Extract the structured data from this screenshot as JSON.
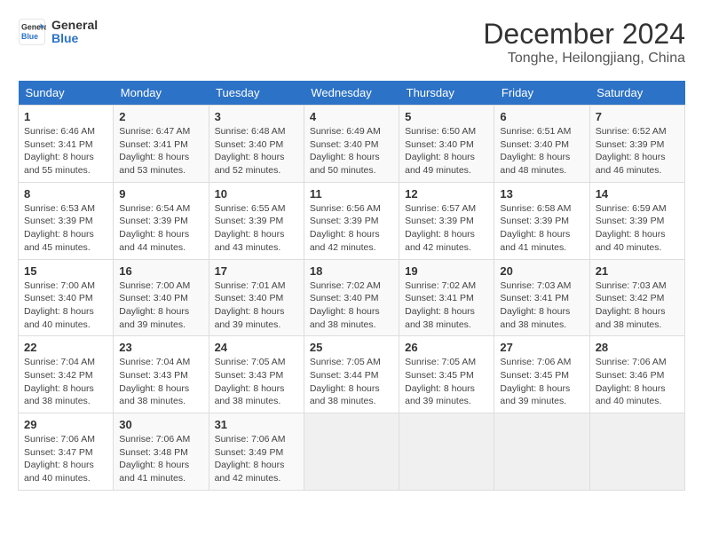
{
  "header": {
    "logo_line1": "General",
    "logo_line2": "Blue",
    "month": "December 2024",
    "location": "Tonghe, Heilongjiang, China"
  },
  "weekdays": [
    "Sunday",
    "Monday",
    "Tuesday",
    "Wednesday",
    "Thursday",
    "Friday",
    "Saturday"
  ],
  "weeks": [
    [
      {
        "day": "1",
        "info": "Sunrise: 6:46 AM\nSunset: 3:41 PM\nDaylight: 8 hours\nand 55 minutes."
      },
      {
        "day": "2",
        "info": "Sunrise: 6:47 AM\nSunset: 3:41 PM\nDaylight: 8 hours\nand 53 minutes."
      },
      {
        "day": "3",
        "info": "Sunrise: 6:48 AM\nSunset: 3:40 PM\nDaylight: 8 hours\nand 52 minutes."
      },
      {
        "day": "4",
        "info": "Sunrise: 6:49 AM\nSunset: 3:40 PM\nDaylight: 8 hours\nand 50 minutes."
      },
      {
        "day": "5",
        "info": "Sunrise: 6:50 AM\nSunset: 3:40 PM\nDaylight: 8 hours\nand 49 minutes."
      },
      {
        "day": "6",
        "info": "Sunrise: 6:51 AM\nSunset: 3:40 PM\nDaylight: 8 hours\nand 48 minutes."
      },
      {
        "day": "7",
        "info": "Sunrise: 6:52 AM\nSunset: 3:39 PM\nDaylight: 8 hours\nand 46 minutes."
      }
    ],
    [
      {
        "day": "8",
        "info": "Sunrise: 6:53 AM\nSunset: 3:39 PM\nDaylight: 8 hours\nand 45 minutes."
      },
      {
        "day": "9",
        "info": "Sunrise: 6:54 AM\nSunset: 3:39 PM\nDaylight: 8 hours\nand 44 minutes."
      },
      {
        "day": "10",
        "info": "Sunrise: 6:55 AM\nSunset: 3:39 PM\nDaylight: 8 hours\nand 43 minutes."
      },
      {
        "day": "11",
        "info": "Sunrise: 6:56 AM\nSunset: 3:39 PM\nDaylight: 8 hours\nand 42 minutes."
      },
      {
        "day": "12",
        "info": "Sunrise: 6:57 AM\nSunset: 3:39 PM\nDaylight: 8 hours\nand 42 minutes."
      },
      {
        "day": "13",
        "info": "Sunrise: 6:58 AM\nSunset: 3:39 PM\nDaylight: 8 hours\nand 41 minutes."
      },
      {
        "day": "14",
        "info": "Sunrise: 6:59 AM\nSunset: 3:39 PM\nDaylight: 8 hours\nand 40 minutes."
      }
    ],
    [
      {
        "day": "15",
        "info": "Sunrise: 7:00 AM\nSunset: 3:40 PM\nDaylight: 8 hours\nand 40 minutes."
      },
      {
        "day": "16",
        "info": "Sunrise: 7:00 AM\nSunset: 3:40 PM\nDaylight: 8 hours\nand 39 minutes."
      },
      {
        "day": "17",
        "info": "Sunrise: 7:01 AM\nSunset: 3:40 PM\nDaylight: 8 hours\nand 39 minutes."
      },
      {
        "day": "18",
        "info": "Sunrise: 7:02 AM\nSunset: 3:40 PM\nDaylight: 8 hours\nand 38 minutes."
      },
      {
        "day": "19",
        "info": "Sunrise: 7:02 AM\nSunset: 3:41 PM\nDaylight: 8 hours\nand 38 minutes."
      },
      {
        "day": "20",
        "info": "Sunrise: 7:03 AM\nSunset: 3:41 PM\nDaylight: 8 hours\nand 38 minutes."
      },
      {
        "day": "21",
        "info": "Sunrise: 7:03 AM\nSunset: 3:42 PM\nDaylight: 8 hours\nand 38 minutes."
      }
    ],
    [
      {
        "day": "22",
        "info": "Sunrise: 7:04 AM\nSunset: 3:42 PM\nDaylight: 8 hours\nand 38 minutes."
      },
      {
        "day": "23",
        "info": "Sunrise: 7:04 AM\nSunset: 3:43 PM\nDaylight: 8 hours\nand 38 minutes."
      },
      {
        "day": "24",
        "info": "Sunrise: 7:05 AM\nSunset: 3:43 PM\nDaylight: 8 hours\nand 38 minutes."
      },
      {
        "day": "25",
        "info": "Sunrise: 7:05 AM\nSunset: 3:44 PM\nDaylight: 8 hours\nand 38 minutes."
      },
      {
        "day": "26",
        "info": "Sunrise: 7:05 AM\nSunset: 3:45 PM\nDaylight: 8 hours\nand 39 minutes."
      },
      {
        "day": "27",
        "info": "Sunrise: 7:06 AM\nSunset: 3:45 PM\nDaylight: 8 hours\nand 39 minutes."
      },
      {
        "day": "28",
        "info": "Sunrise: 7:06 AM\nSunset: 3:46 PM\nDaylight: 8 hours\nand 40 minutes."
      }
    ],
    [
      {
        "day": "29",
        "info": "Sunrise: 7:06 AM\nSunset: 3:47 PM\nDaylight: 8 hours\nand 40 minutes."
      },
      {
        "day": "30",
        "info": "Sunrise: 7:06 AM\nSunset: 3:48 PM\nDaylight: 8 hours\nand 41 minutes."
      },
      {
        "day": "31",
        "info": "Sunrise: 7:06 AM\nSunset: 3:49 PM\nDaylight: 8 hours\nand 42 minutes."
      },
      null,
      null,
      null,
      null
    ]
  ]
}
